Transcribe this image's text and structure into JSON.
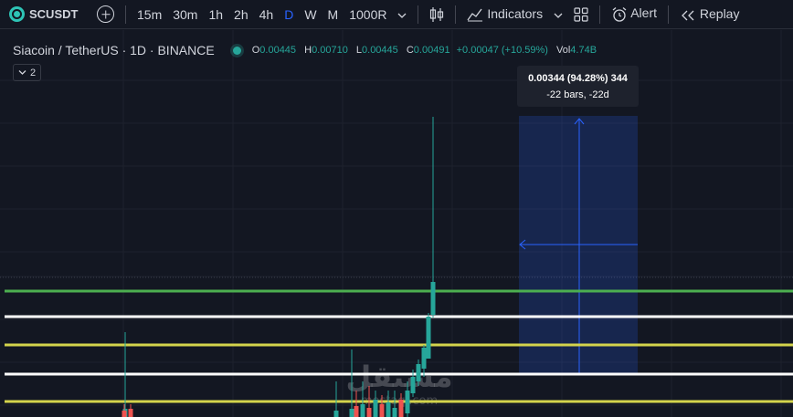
{
  "toolbar": {
    "symbol": "SCUSDT",
    "intervals": [
      "15m",
      "30m",
      "1h",
      "2h",
      "4h",
      "D",
      "W",
      "M",
      "1000R"
    ],
    "active_interval": "D",
    "indicators_label": "Indicators",
    "alert_label": "Alert",
    "replay_label": "Replay"
  },
  "legend": {
    "title": "Siacoin / TetherUS · 1D · BINANCE",
    "o_label": "O",
    "o_value": "0.00445",
    "h_label": "H",
    "h_value": "0.00710",
    "l_label": "L",
    "l_value": "0.00445",
    "c_label": "C",
    "c_value": "0.00491",
    "change": "+0.00047 (+10.59%)",
    "vol_label": "Vol",
    "vol_value": "4.74B",
    "indicator_count": "2"
  },
  "measure_tooltip": {
    "line1": "0.00344 (94.28%) 344",
    "line2": "-22 bars, -22d"
  },
  "watermark": "مستقل",
  "watermark_sub": "mostaql.com",
  "chart_data": {
    "type": "candlestick",
    "symbol": "SCUSDT",
    "timeframe": "1D",
    "last_candle": {
      "open": 0.00445,
      "high": 0.0071,
      "low": 0.00445,
      "close": 0.00491
    },
    "horizontal_lines": [
      {
        "color": "#4caf50"
      },
      {
        "color": "#ffffff"
      },
      {
        "color": "#d4d44c"
      },
      {
        "color": "#ffffff"
      },
      {
        "color": "#d4d44c"
      }
    ],
    "colors": {
      "up": "#26a69a",
      "down": "#ef5350",
      "measure": "#2962ff"
    }
  }
}
